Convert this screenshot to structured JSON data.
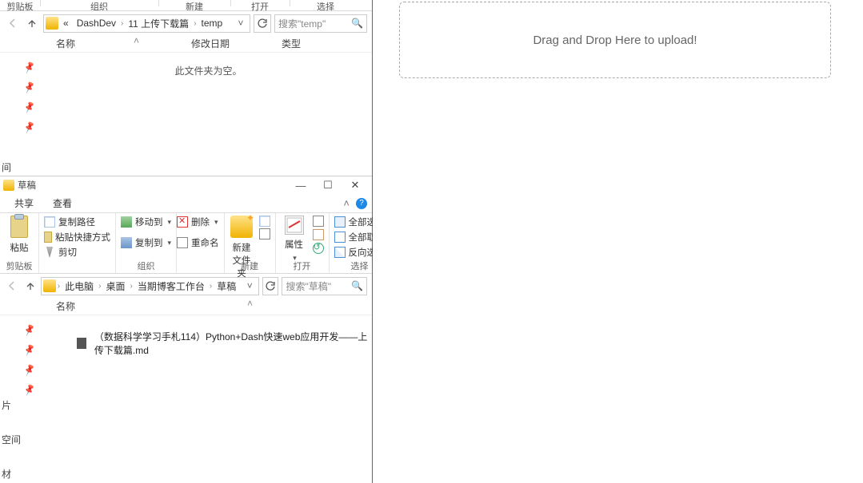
{
  "ribbon_sections": {
    "clipboard": "剪贴板",
    "organize": "组织",
    "new": "新建",
    "open": "打开",
    "select": "选择"
  },
  "win1": {
    "breadcrumb_prefix": "«",
    "crumbs": [
      "DashDev",
      "11 上传下载篇",
      "temp"
    ],
    "search_placeholder": "搜索\"temp\"",
    "columns": {
      "name": "名称",
      "modified": "修改日期",
      "type": "类型"
    },
    "empty_msg": "此文件夹为空。",
    "side_items": [
      "间"
    ]
  },
  "titlebar": {
    "title": "草稿"
  },
  "tabs": {
    "share": "共享",
    "view": "查看"
  },
  "ribbon": {
    "clipboard": {
      "paste": "粘贴",
      "copy_path": "复制路径",
      "paste_shortcut": "粘贴快捷方式",
      "cut": "剪切"
    },
    "organize": {
      "move_to": "移动到",
      "copy_to": "复制到",
      "delete": "删除",
      "rename": "重命名"
    },
    "new": {
      "new_folder": "新建\n文件夹"
    },
    "open": {
      "properties": "属性"
    },
    "select": {
      "select_all": "全部选择",
      "select_none": "全部取消",
      "invert": "反向选择"
    }
  },
  "win2": {
    "crumbs": [
      "此电脑",
      "桌面",
      "当期博客工作台",
      "草稿"
    ],
    "search_placeholder": "搜索\"草稿\"",
    "columns": {
      "name": "名称"
    },
    "files": [
      "（数据科学学习手札114）Python+Dash快速web应用开发——上传下载篇.md"
    ],
    "side_items": [
      "片",
      "空间",
      "材"
    ]
  },
  "dropzone": {
    "text": "Drag and Drop Here to upload!"
  }
}
